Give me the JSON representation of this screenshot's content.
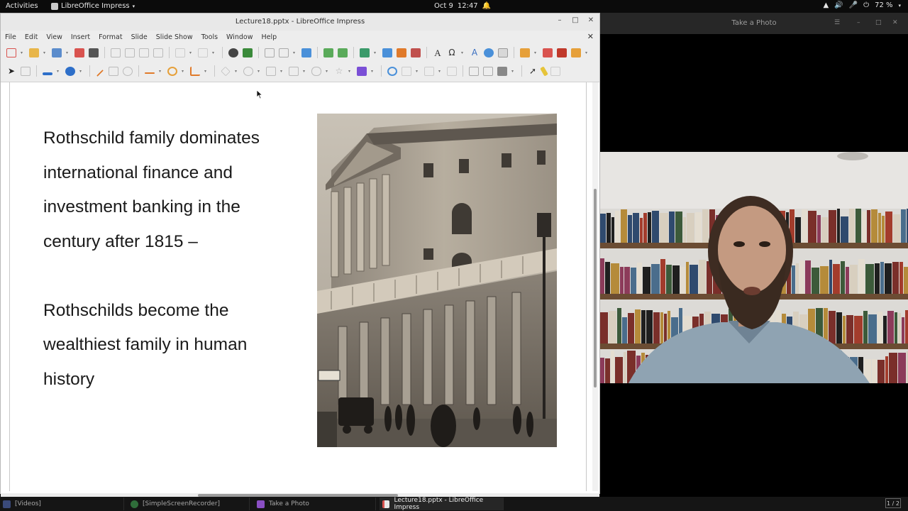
{
  "topbar": {
    "activities": "Activities",
    "app_name": "LibreOffice Impress",
    "clock_date": "Oct 9",
    "clock_time": "12:47",
    "battery": "72 %"
  },
  "impress": {
    "window_title": "Lecture18.pptx - LibreOffice Impress",
    "menu": [
      "File",
      "Edit",
      "View",
      "Insert",
      "Format",
      "Slide",
      "Slide Show",
      "Tools",
      "Window",
      "Help"
    ],
    "slide": {
      "paragraph1": [
        "Rothschild family dominates",
        "international finance and",
        "investment banking in the",
        "century after 1815 –"
      ],
      "paragraph2": [
        "Rothschilds become the",
        "wealthiest family in human",
        "history"
      ]
    }
  },
  "camera": {
    "window_title": "Take a Photo"
  },
  "taskbar": {
    "items": [
      "[Videos]",
      "[SimpleScreenRecorder]",
      "Take a Photo",
      "Lecture18.pptx - LibreOffice Impress"
    ],
    "workspace": "1 / 2"
  },
  "colors": {
    "lo_window_bg": "#ededed",
    "slide_bg": "#ffffff",
    "cam_titlebar": "#272727",
    "taskbar": "#151515"
  }
}
